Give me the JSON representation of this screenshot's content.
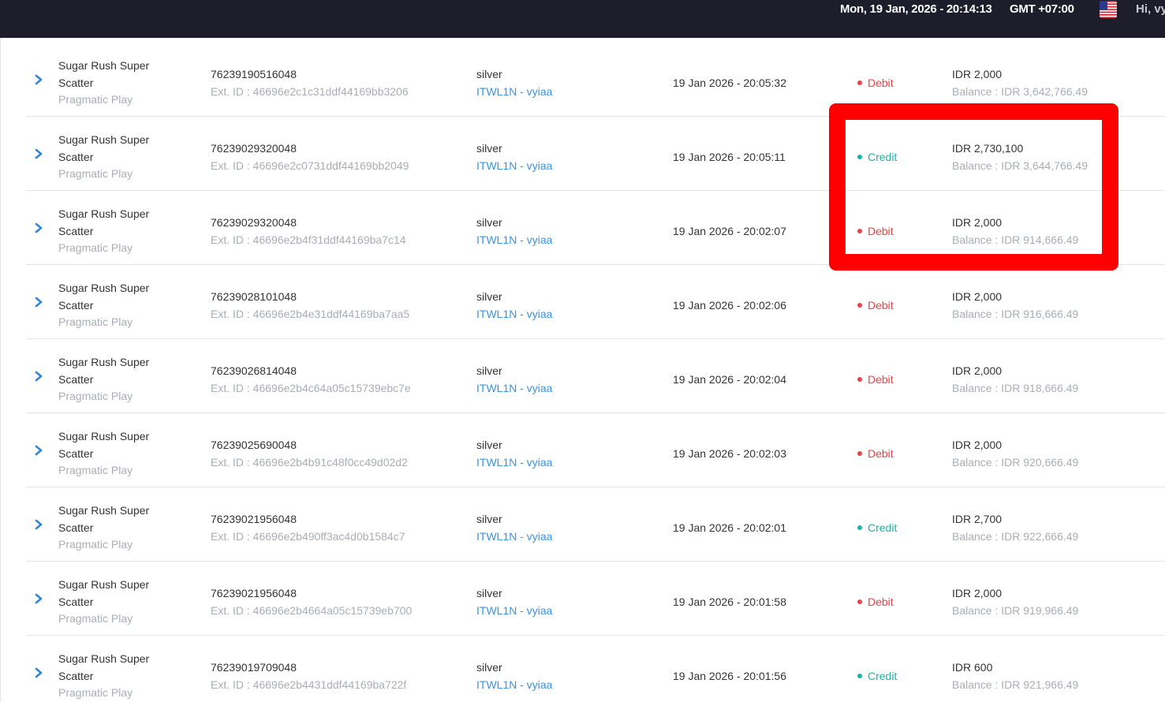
{
  "header": {
    "datetime": "Mon, 19 Jan, 2026 - 20:14:13",
    "timezone": "GMT +07:00",
    "greeting": "Hi, vy",
    "flag_icon": "us-flag-icon"
  },
  "colors": {
    "header_bg": "#1d1d2b",
    "debit": "#e8424a",
    "credit": "#1bb5a5",
    "link": "#3b93e3",
    "highlight": "#ff0000"
  },
  "transactions": [
    {
      "game_line1": "Sugar Rush Super",
      "game_line2": "Scatter",
      "provider": "Pragmatic Play",
      "txn_id": "76239190516048",
      "ext_id": "Ext. ID : 46696e2c1c31ddf44169bb3206",
      "level": "silver",
      "account": "ITWL1N - vyiaa",
      "datetime": "19 Jan 2026 - 20:05:32",
      "type": "Debit",
      "amount": "IDR 2,000",
      "balance": "Balance : IDR 3,642,766.49"
    },
    {
      "game_line1": "Sugar Rush Super",
      "game_line2": "Scatter",
      "provider": "Pragmatic Play",
      "txn_id": "76239029320048",
      "ext_id": "Ext. ID : 46696e2c0731ddf44169bb2049",
      "level": "silver",
      "account": "ITWL1N - vyiaa",
      "datetime": "19 Jan 2026 - 20:05:11",
      "type": "Credit",
      "amount": "IDR 2,730,100",
      "balance": "Balance : IDR 3,644,766.49"
    },
    {
      "game_line1": "Sugar Rush Super",
      "game_line2": "Scatter",
      "provider": "Pragmatic Play",
      "txn_id": "76239029320048",
      "ext_id": "Ext. ID : 46696e2b4f31ddf44169ba7c14",
      "level": "silver",
      "account": "ITWL1N - vyiaa",
      "datetime": "19 Jan 2026 - 20:02:07",
      "type": "Debit",
      "amount": "IDR 2,000",
      "balance": "Balance : IDR 914,666.49"
    },
    {
      "game_line1": "Sugar Rush Super",
      "game_line2": "Scatter",
      "provider": "Pragmatic Play",
      "txn_id": "76239028101048",
      "ext_id": "Ext. ID : 46696e2b4e31ddf44169ba7aa5",
      "level": "silver",
      "account": "ITWL1N - vyiaa",
      "datetime": "19 Jan 2026 - 20:02:06",
      "type": "Debit",
      "amount": "IDR 2,000",
      "balance": "Balance : IDR 916,666.49"
    },
    {
      "game_line1": "Sugar Rush Super",
      "game_line2": "Scatter",
      "provider": "Pragmatic Play",
      "txn_id": "76239026814048",
      "ext_id": "Ext. ID : 46696e2b4c64a05c15739ebc7e",
      "level": "silver",
      "account": "ITWL1N - vyiaa",
      "datetime": "19 Jan 2026 - 20:02:04",
      "type": "Debit",
      "amount": "IDR 2,000",
      "balance": "Balance : IDR 918,666.49"
    },
    {
      "game_line1": "Sugar Rush Super",
      "game_line2": "Scatter",
      "provider": "Pragmatic Play",
      "txn_id": "76239025690048",
      "ext_id": "Ext. ID : 46696e2b4b91c48f0cc49d02d2",
      "level": "silver",
      "account": "ITWL1N - vyiaa",
      "datetime": "19 Jan 2026 - 20:02:03",
      "type": "Debit",
      "amount": "IDR 2,000",
      "balance": "Balance : IDR 920,666.49"
    },
    {
      "game_line1": "Sugar Rush Super",
      "game_line2": "Scatter",
      "provider": "Pragmatic Play",
      "txn_id": "76239021956048",
      "ext_id": "Ext. ID : 46696e2b490ff3ac4d0b1584c7",
      "level": "silver",
      "account": "ITWL1N - vyiaa",
      "datetime": "19 Jan 2026 - 20:02:01",
      "type": "Credit",
      "amount": "IDR 2,700",
      "balance": "Balance : IDR 922,666.49"
    },
    {
      "game_line1": "Sugar Rush Super",
      "game_line2": "Scatter",
      "provider": "Pragmatic Play",
      "txn_id": "76239021956048",
      "ext_id": "Ext. ID : 46696e2b4664a05c15739eb700",
      "level": "silver",
      "account": "ITWL1N - vyiaa",
      "datetime": "19 Jan 2026 - 20:01:58",
      "type": "Debit",
      "amount": "IDR 2,000",
      "balance": "Balance : IDR 919,966.49"
    },
    {
      "game_line1": "Sugar Rush Super",
      "game_line2": "Scatter",
      "provider": "Pragmatic Play",
      "txn_id": "76239019709048",
      "ext_id": "Ext. ID : 46696e2b4431ddf44169ba722f",
      "level": "silver",
      "account": "ITWL1N - vyiaa",
      "datetime": "19 Jan 2026 - 20:01:56",
      "type": "Credit",
      "amount": "IDR 600",
      "balance": "Balance : IDR 921,966.49"
    }
  ]
}
